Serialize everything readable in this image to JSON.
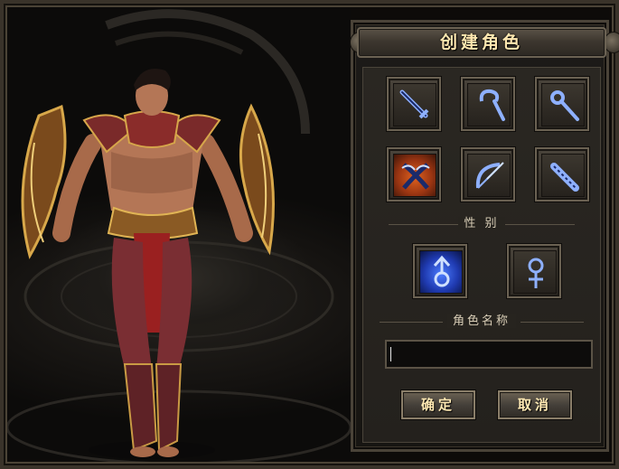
{
  "dialog": {
    "title": "创建角色"
  },
  "classes": [
    {
      "icon": "sword-icon",
      "selected": false
    },
    {
      "icon": "hook-staff-icon",
      "selected": false
    },
    {
      "icon": "scepter-icon",
      "selected": false
    },
    {
      "icon": "twin-blades-icon",
      "selected": true
    },
    {
      "icon": "bow-icon",
      "selected": false
    },
    {
      "icon": "gauntlet-icon",
      "selected": false
    }
  ],
  "gender": {
    "label": "性 别",
    "options": [
      {
        "icon": "male-symbol-icon",
        "selected": true
      },
      {
        "icon": "female-symbol-icon",
        "selected": false
      }
    ]
  },
  "name_field": {
    "label": "角色名称",
    "value": ""
  },
  "buttons": {
    "confirm": "确定",
    "cancel": "取消"
  },
  "colors": {
    "title_text": "#ffe7b0",
    "selected_class": "#e0621e",
    "selected_gender": "#4b7cff"
  }
}
